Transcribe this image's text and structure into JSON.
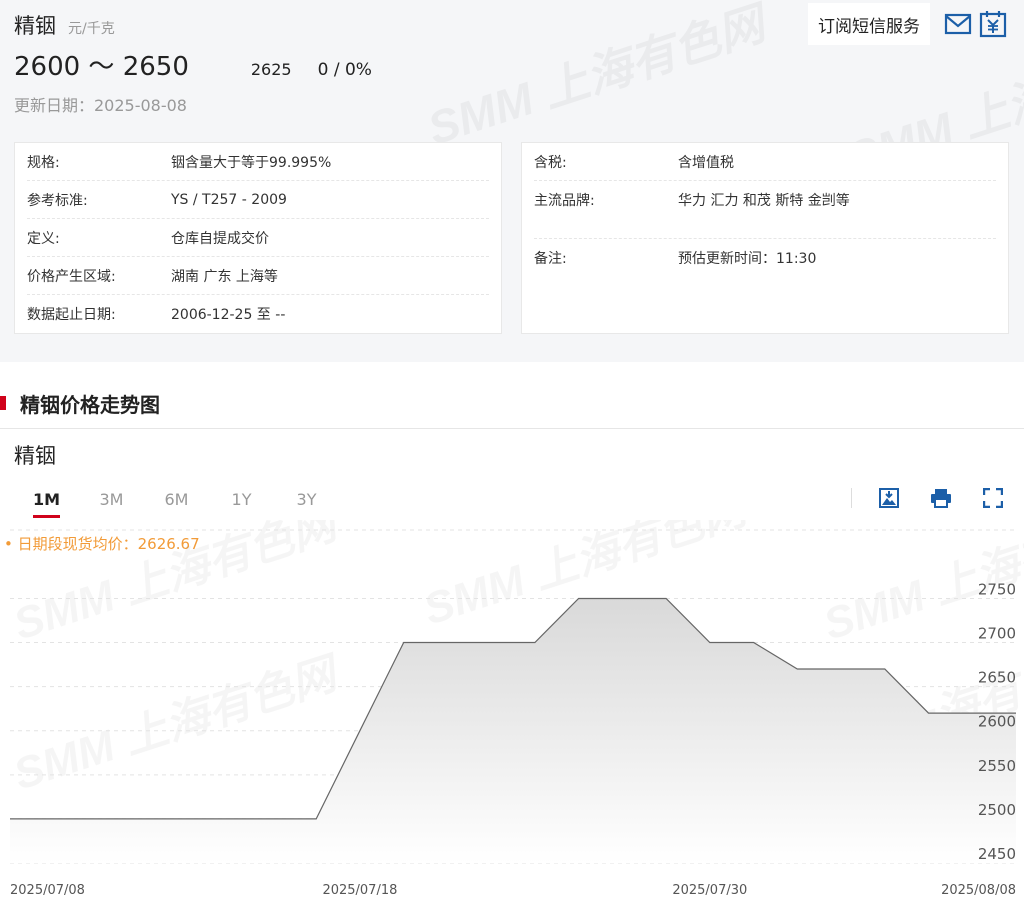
{
  "header": {
    "title": "精铟",
    "unit": "元/千克",
    "price_range": "2600 ～ 2650",
    "avg_price": "2625",
    "change": "0  /  0%",
    "update_date": "更新日期：2025-08-08",
    "subscribe_label": "订阅短信服务"
  },
  "watermark": {
    "text": "SMM 上海有色网"
  },
  "specs_left": [
    {
      "k": "规格:",
      "v": "铟含量大于等于99.995%"
    },
    {
      "k": "参考标准:",
      "v": "YS / T257 - 2009"
    },
    {
      "k": "定义:",
      "v": "仓库自提成交价"
    },
    {
      "k": "价格产生区域:",
      "v": "湖南 广东 上海等"
    },
    {
      "k": "数据起止日期:",
      "v": "2006-12-25 至 --"
    }
  ],
  "specs_right": [
    {
      "k": "含税:",
      "v": "含增值税"
    },
    {
      "k": "主流品牌:",
      "v": "华力 汇力 和茂 斯特 金剀等"
    },
    {
      "k": "备注:",
      "v": "预估更新时间：11:30"
    }
  ],
  "section": {
    "title": "精铟价格走势图"
  },
  "chart_panel": {
    "name": "精铟",
    "tabs": [
      "1M",
      "3M",
      "6M",
      "1Y",
      "3Y"
    ],
    "active_tab": "1M",
    "avg_note": "• 日期段现货均价：2626.67"
  },
  "colors": {
    "accent": "#d0021b",
    "icon_blue": "#1c5fa8",
    "avg_orange": "#f29b38"
  },
  "chart_data": {
    "type": "area",
    "x": [
      "2025/07/08",
      "2025/07/09",
      "2025/07/10",
      "2025/07/11",
      "2025/07/14",
      "2025/07/15",
      "2025/07/16",
      "2025/07/17",
      "2025/07/18",
      "2025/07/21",
      "2025/07/22",
      "2025/07/23",
      "2025/07/24",
      "2025/07/25",
      "2025/07/28",
      "2025/07/29",
      "2025/07/30",
      "2025/07/31",
      "2025/08/01",
      "2025/08/04",
      "2025/08/05",
      "2025/08/06",
      "2025/08/07",
      "2025/08/08"
    ],
    "values": [
      2500,
      2500,
      2500,
      2500,
      2500,
      2500,
      2500,
      2500,
      2600,
      2700,
      2700,
      2700,
      2700,
      2750,
      2750,
      2750,
      2700,
      2700,
      2670,
      2670,
      2670,
      2620,
      2620,
      2620
    ],
    "x_tick_labels": [
      "2025/07/08",
      "2025/07/18",
      "2025/07/30",
      "2025/08/08"
    ],
    "y_ticks": [
      2450,
      2500,
      2550,
      2600,
      2650,
      2700,
      2750
    ],
    "ylim": [
      2450,
      2780
    ],
    "grid": true,
    "y_axis_side": "right"
  }
}
